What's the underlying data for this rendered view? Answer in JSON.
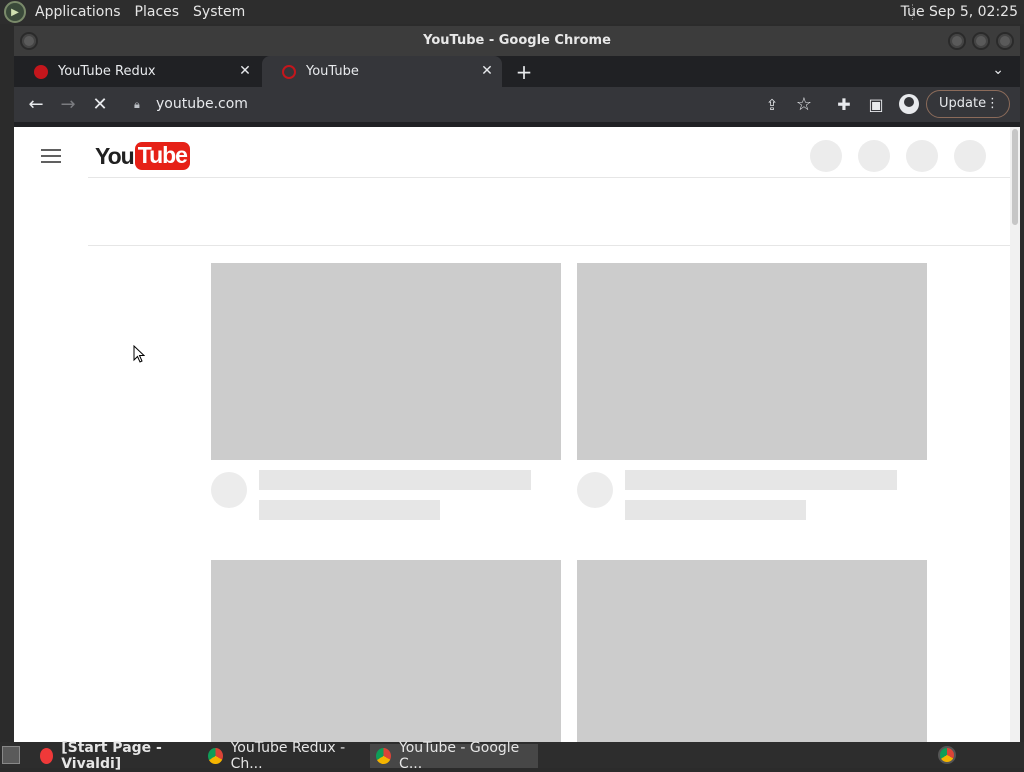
{
  "top_panel": {
    "menus": [
      "Applications",
      "Places",
      "System"
    ],
    "clock": "Tue Sep  5, 02:25"
  },
  "window": {
    "title": "YouTube - Google Chrome"
  },
  "tabs": [
    {
      "title": "YouTube Redux",
      "active": false
    },
    {
      "title": "YouTube",
      "active": true
    }
  ],
  "toolbar": {
    "url": "youtube.com",
    "update_label": "Update"
  },
  "page": {
    "logo_you": "You",
    "logo_tube": "Tube"
  },
  "taskbar": {
    "items": [
      {
        "label": "[Start Page - Vivaldi]",
        "active": false
      },
      {
        "label": "YouTube Redux - Ch...",
        "active": false
      },
      {
        "label": "YouTube - Google C...",
        "active": true
      }
    ]
  },
  "colors": {
    "youtube_red": "#e62117",
    "placeholder_gray": "#cccccc",
    "update_border": "#8b6b5a"
  }
}
